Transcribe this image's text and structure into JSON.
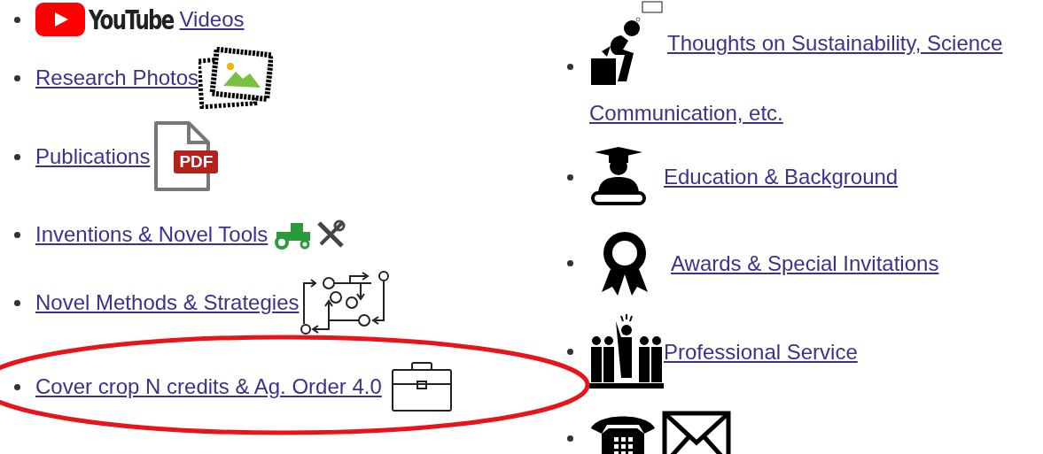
{
  "left_list": [
    {
      "kind": "youtube",
      "logo_text": "YouTube",
      "label": "Videos",
      "highlighted": false
    },
    {
      "kind": "photos",
      "label": "Research Photos",
      "highlighted": false
    },
    {
      "kind": "pdf",
      "label": "Publications",
      "icon_text": "PDF",
      "highlighted": false
    },
    {
      "kind": "tools",
      "label": "Inventions & Novel Tools",
      "highlighted": false
    },
    {
      "kind": "methods",
      "label": "Novel Methods & Strategies",
      "highlighted": false
    },
    {
      "kind": "briefcase",
      "label": "Cover crop N credits & Ag. Order 4.0",
      "highlighted": true
    }
  ],
  "right_list": [
    {
      "kind": "thinker",
      "label_lines": [
        "Thoughts on Sustainability, Science",
        "Communication, etc."
      ]
    },
    {
      "kind": "graduate",
      "label": "Education & Background"
    },
    {
      "kind": "award",
      "label": "Awards & Special Invitations"
    },
    {
      "kind": "team",
      "label": "Professional Service"
    },
    {
      "kind": "contact"
    }
  ]
}
